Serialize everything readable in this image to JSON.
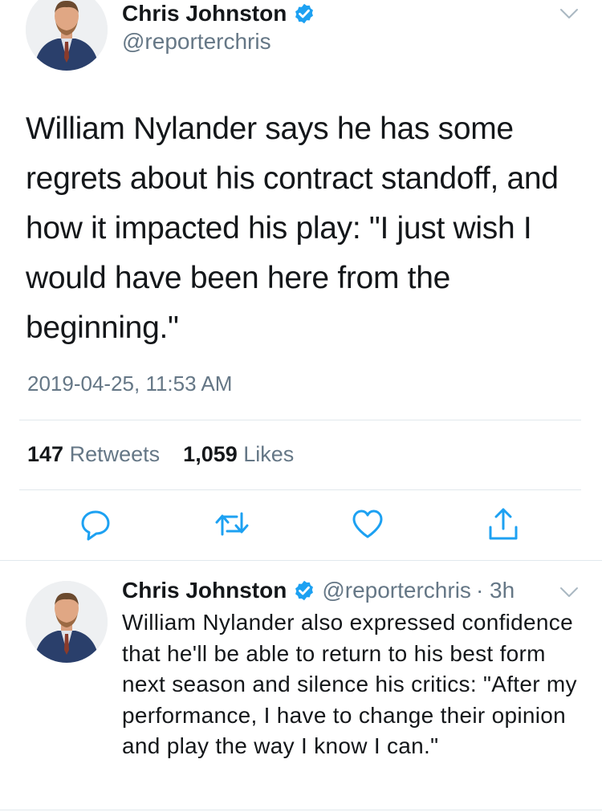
{
  "main_tweet": {
    "author": {
      "name": "Chris Johnston",
      "handle": "@reporterchris"
    },
    "text": "William Nylander says he has some regrets about his contract standoff, and how it impacted his play: \"I just wish I would have been here from the beginning.\"",
    "timestamp": "2019-04-25, 11:53 AM",
    "stats": {
      "retweets_count": "147",
      "retweets_label": "Retweets",
      "likes_count": "1,059",
      "likes_label": "Likes"
    },
    "actions": [
      "reply-icon",
      "retweet-icon",
      "like-icon",
      "share-icon"
    ]
  },
  "reply_tweet": {
    "author": {
      "name": "Chris Johnston",
      "handle": "@reporterchris"
    },
    "time": "· 3h",
    "text": "William Nylander also expressed confidence that he'll be able to return to his best form next season and silence his critics: \"After my performance, I have to change their opinion and play the way I know I can.\""
  },
  "colors": {
    "text": "#14171a",
    "secondary": "#657786",
    "verified": "#1da1f2",
    "divider": "#e1e8ed"
  }
}
